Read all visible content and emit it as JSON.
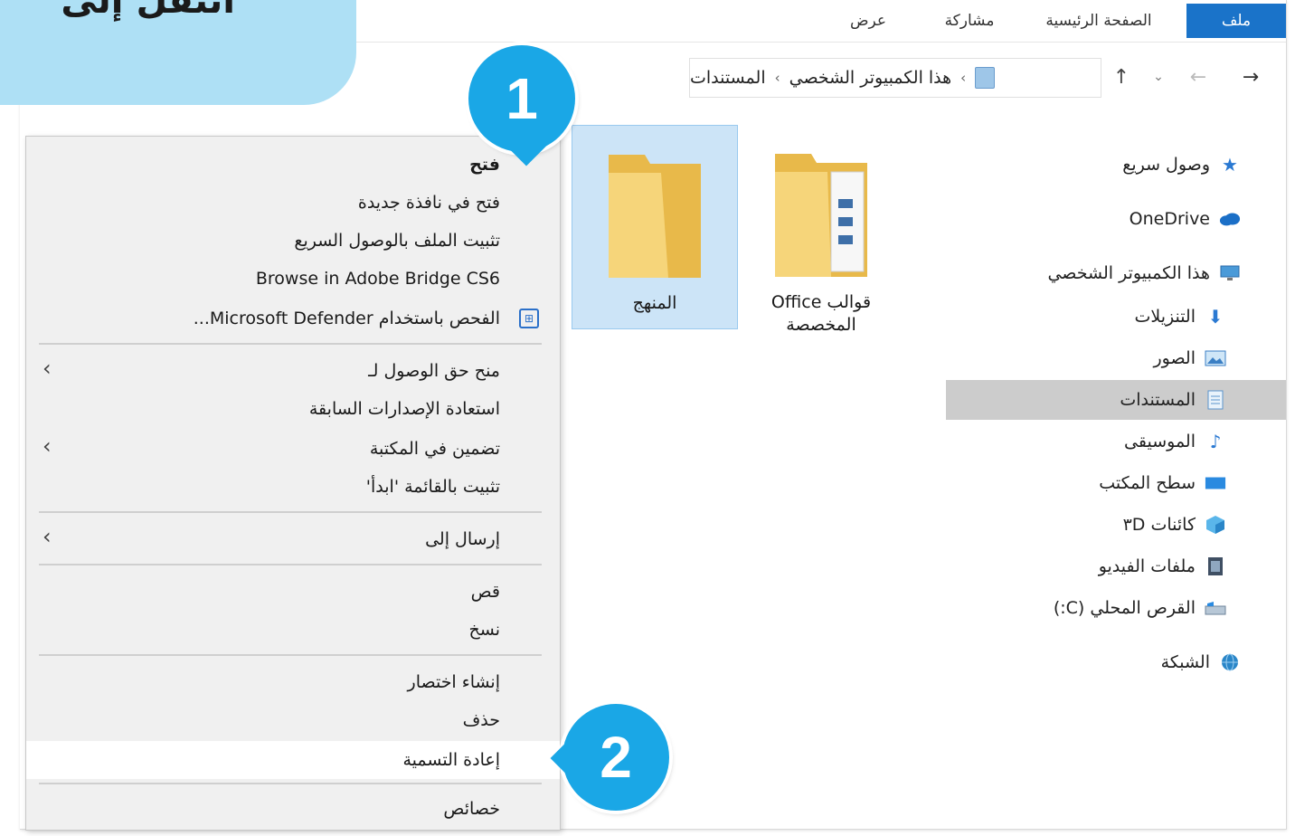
{
  "callout": {
    "text": "انتقل إلى"
  },
  "ribbon": {
    "tabs": [
      "ملف",
      "الصفحة الرئيسية",
      "مشاركة",
      "عرض"
    ]
  },
  "navigation": {
    "back_icon": "arrow-right-icon",
    "forward_icon": "arrow-left-icon",
    "up_icon": "arrow-up-icon",
    "breadcrumb": [
      "هذا الكمبيوتر الشخصي",
      "المستندات"
    ],
    "separator": "›"
  },
  "sidebar": {
    "items": [
      {
        "label": "وصول سريع",
        "icon": "star-icon"
      },
      {
        "label": "OneDrive",
        "icon": "cloud-icon"
      },
      {
        "label": "هذا الكمبيوتر الشخصي",
        "icon": "computer-icon"
      },
      {
        "label": "التنزيلات",
        "icon": "download-icon"
      },
      {
        "label": "الصور",
        "icon": "pictures-icon"
      },
      {
        "label": "المستندات",
        "icon": "documents-icon",
        "selected": true
      },
      {
        "label": "الموسيقى",
        "icon": "music-icon"
      },
      {
        "label": "سطح المكتب",
        "icon": "desktop-icon"
      },
      {
        "label": "كائنات ثلاثية الأبعاد",
        "display": "كائنات ٣D",
        "icon": "cube-icon"
      },
      {
        "label": "ملفات الفيديو",
        "icon": "video-icon"
      },
      {
        "label": "القرص المحلي (C:)",
        "icon": "drive-icon"
      },
      {
        "label": "الشبكة",
        "icon": "network-icon"
      }
    ]
  },
  "files": [
    {
      "name": "قوالب Office المخصصة",
      "line1": "قوالب Office المخصصة",
      "line2": "",
      "icon": "folder-documents-icon"
    },
    {
      "name": "المنهج",
      "icon": "folder-icon",
      "selected": true
    }
  ],
  "context_menu": {
    "items": [
      {
        "label": "فتح",
        "bold": true
      },
      {
        "label": "فتح في نافذة جديدة"
      },
      {
        "label": "تثبيت الملف بالوصول السريع"
      },
      {
        "label": "Browse in Adobe Bridge CS6"
      },
      {
        "label": "الفحص باستخدام Microsoft Defender...",
        "icon": "defender-icon"
      },
      {
        "label": "منح حق الوصول لـ",
        "submenu": true
      },
      {
        "label": "استعادة الإصدارات السابقة"
      },
      {
        "label": "تضمين في المكتبة",
        "submenu": true
      },
      {
        "label": "تثبيت بالقائمة 'ابدأ'"
      },
      {
        "label": "إرسال إلى",
        "submenu": true
      },
      {
        "label": "قص"
      },
      {
        "label": "نسخ"
      },
      {
        "label": "إنشاء اختصار"
      },
      {
        "label": "حذف"
      },
      {
        "label": "إعادة التسمية",
        "highlight": true
      },
      {
        "label": "خصائص"
      }
    ]
  },
  "markers": [
    "1",
    "2"
  ],
  "colors": {
    "accent": "#1a73c9",
    "marker": "#1aa7e6",
    "callout": "#aee0f5",
    "selection": "#cce4f7",
    "menu_bg": "#f0f0f0"
  }
}
